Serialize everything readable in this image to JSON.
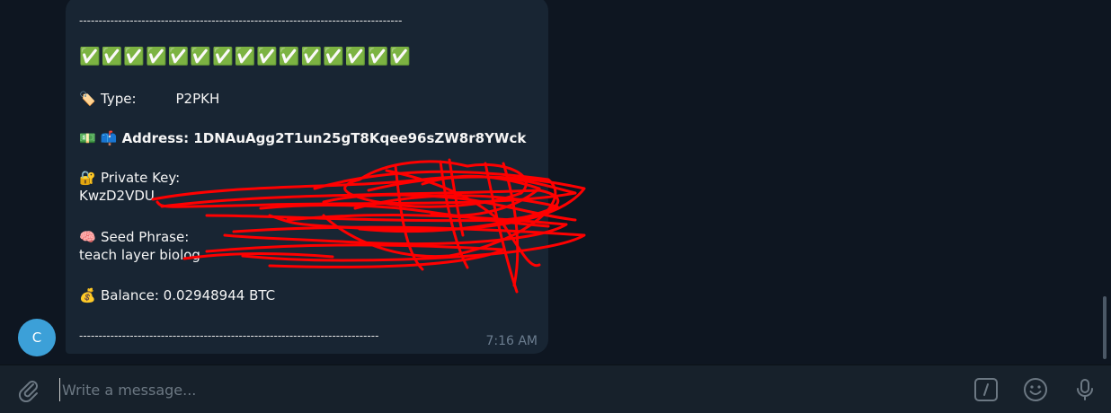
{
  "message": {
    "separator_top": "-----------------------------------------------------------------------------------",
    "checkmarks": "✅✅✅✅✅✅✅✅✅✅✅✅✅✅✅",
    "type_emoji": "🏷️",
    "type_label": "Type:",
    "type_value": "P2PKH",
    "address_emojis": "💵 📫",
    "address_label": "Address: 1DNAuAgg2T1un25gT8Kqee96sZW8r8YWck",
    "private_key_emoji": "🔐",
    "private_key_label": "Private Key:",
    "private_key_value": "KwzD2VDU",
    "seed_emoji": "🧠",
    "seed_label": "Seed Phrase:",
    "seed_value_line2": "teach layer biolog",
    "balance_emoji": "💰",
    "balance_text": "Balance: 0.02948944 BTC",
    "separator_bottom": "-----------------------------------------------------------------------------",
    "time": "7:16 AM"
  },
  "avatar": {
    "initial": "C",
    "color": "#3ca0d8"
  },
  "composer": {
    "placeholder": "Write a message...",
    "attach_icon": "paperclip-icon",
    "commands_icon": "slash-command-icon",
    "emoji_icon": "smiley-icon",
    "mic_icon": "microphone-icon"
  },
  "colors": {
    "background": "#0e1621",
    "bubble": "#182533",
    "composer": "#17212b",
    "redaction": "#ff0000"
  }
}
